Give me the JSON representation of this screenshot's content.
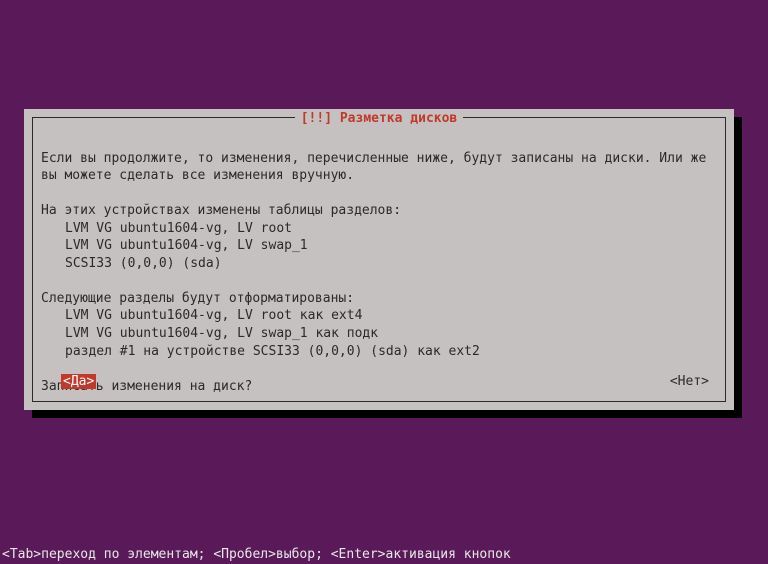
{
  "dialog": {
    "title": "[!!] Разметка дисков",
    "para1": "Если вы продолжите, то изменения, перечисленные ниже, будут записаны на диски. Или же вы можете сделать все изменения вручную.",
    "section1_header": "На этих устройствах изменены таблицы разделов:",
    "section1_items": [
      "LVM VG ubuntu1604-vg, LV root",
      "LVM VG ubuntu1604-vg, LV swap_1",
      "SCSI33 (0,0,0) (sda)"
    ],
    "section2_header": "Следующие разделы будут отформатированы:",
    "section2_items": [
      "LVM VG ubuntu1604-vg, LV root как ext4",
      "LVM VG ubuntu1604-vg, LV swap_1 как подк",
      "раздел #1 на устройстве SCSI33 (0,0,0) (sda) как ext2"
    ],
    "question": "Записать изменения на диск?",
    "yes": "<Да>",
    "no": "<Нет>",
    "selected": "yes"
  },
  "statusbar": "<Tab>переход по элементам; <Пробел>выбор; <Enter>активация кнопок"
}
